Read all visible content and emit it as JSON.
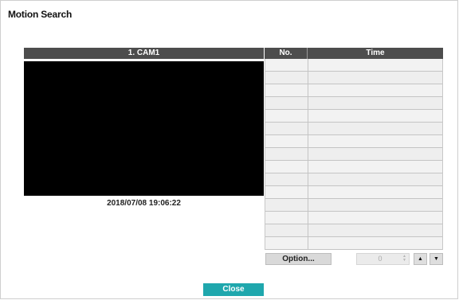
{
  "window": {
    "title": "Motion Search"
  },
  "camera": {
    "header": "1. CAM1",
    "timestamp": "2018/07/08  19:06:22"
  },
  "results_table": {
    "columns": [
      "No.",
      "Time"
    ],
    "rows": [
      "",
      "",
      "",
      "",
      "",
      "",
      "",
      "",
      "",
      "",
      "",
      "",
      "",
      "",
      ""
    ]
  },
  "controls": {
    "option_label": "Option...",
    "spin_value": "0",
    "up_icon": "triangle-up-icon",
    "down_icon": "triangle-down-icon"
  },
  "footer": {
    "close_label": "Close"
  },
  "colors": {
    "header_bg": "#4d4d4d",
    "close_button": "#1fa7ad",
    "video_bg": "#000000"
  }
}
